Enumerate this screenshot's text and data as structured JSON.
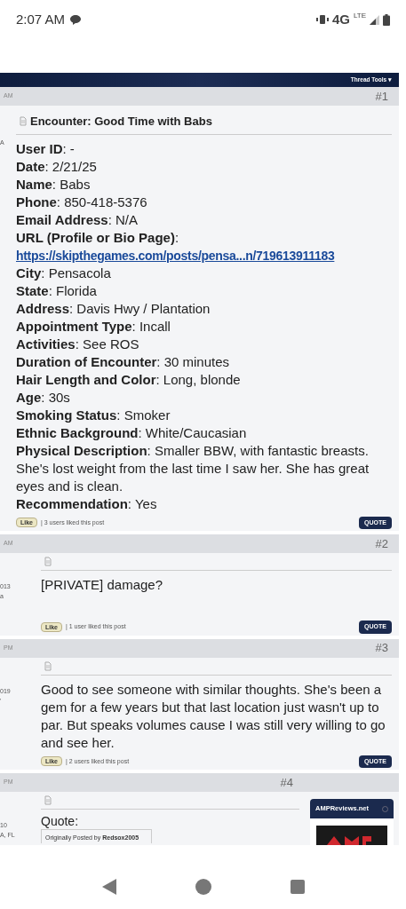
{
  "status_bar": {
    "time": "2:07 AM",
    "network": "4G",
    "network_sub": "LTE"
  },
  "toolbar": {
    "menu": "Thread Tools ▾"
  },
  "posts": [
    {
      "time": "AM",
      "number": "#1",
      "side": [
        "A"
      ],
      "title": "Encounter: Good Time with Babs",
      "fields": [
        {
          "kind": "text",
          "text": "**User ID**: -"
        },
        {
          "kind": "text",
          "text": "**Date**: 2/21/25"
        },
        {
          "kind": "text",
          "text": "**Name**: Babs"
        },
        {
          "kind": "text",
          "text": "**Phone**: 850-418-5376"
        },
        {
          "kind": "text",
          "text": "**Email Address**: N/A"
        },
        {
          "kind": "text",
          "text": "**URL (Profile or Bio Page)**:"
        },
        {
          "kind": "link",
          "text": "https://skipthegames.com/posts/pensa...n/719613911183"
        },
        {
          "kind": "text",
          "text": "**City**: Pensacola"
        },
        {
          "kind": "text",
          "text": "**State**: Florida"
        },
        {
          "kind": "text",
          "text": "**Address**: Davis Hwy / Plantation"
        },
        {
          "kind": "text",
          "text": "**Appointment Type**: Incall"
        },
        {
          "kind": "text",
          "text": "**Activities**: See ROS"
        },
        {
          "kind": "text",
          "text": "**Duration of Encounter**: 30 minutes"
        },
        {
          "kind": "text",
          "text": "**Hair Length and Color**: Long, blonde"
        },
        {
          "kind": "text",
          "text": "**Age**: 30s"
        },
        {
          "kind": "text",
          "text": "**Smoking Status**: Smoker"
        },
        {
          "kind": "text",
          "text": "**Ethnic Background**: White/Caucasian"
        },
        {
          "kind": "text",
          "text": "**Physical Description**: Smaller BBW, with fantastic breasts. She's lost weight from the last time I saw her. She has great eyes and is clean."
        },
        {
          "kind": "text",
          "text": "**Recommendation**: Yes"
        }
      ],
      "like": "Like",
      "likes": "| 3 users liked this post",
      "quote": "QUOTE"
    },
    {
      "time": "AM",
      "number": "#2",
      "side": [
        "013",
        "a"
      ],
      "fields": [
        {
          "kind": "text",
          "text": "[PRIVATE] damage?"
        }
      ],
      "like": "Like",
      "likes": "| 1 user liked this post",
      "quote": "QUOTE"
    },
    {
      "time": "PM",
      "number": "#3",
      "side": [
        "019",
        "'"
      ],
      "fields": [
        {
          "kind": "text",
          "text": "Good to see someone with similar thoughts. She's been a gem for a few years but that last location just wasn't up to par. But speaks volumes cause I was still very willing to go and see her."
        }
      ],
      "like": "Like",
      "likes": "| 2 users liked this post",
      "quote": "QUOTE"
    },
    {
      "time": "PM",
      "number": "#4",
      "side": [
        "10",
        "A, FL"
      ],
      "quote_label": "Quote:",
      "quote_by": "Originally Posted by **Redsox2005**",
      "ad": {
        "title": "AMPReviews.net"
      }
    }
  ]
}
